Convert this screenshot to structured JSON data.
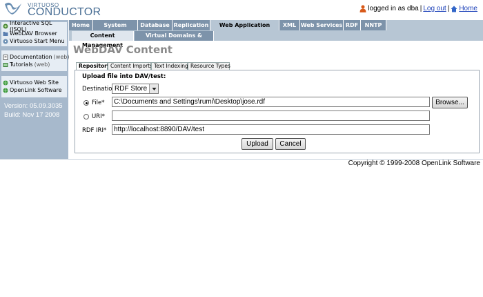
{
  "header": {
    "logo_small": "VIRTUOSO",
    "logo_big": "CONDUCTOR",
    "login_text": "logged in as dba",
    "separator": "|",
    "logout_label": "Log out",
    "home_label": "Home"
  },
  "tabs": [
    "Home",
    "System Admin",
    "Database",
    "Replication",
    "Web Application Server",
    "XML",
    "Web Services",
    "RDF",
    "NNTP"
  ],
  "active_tab": "Web Application Server",
  "subtabs": [
    "Content Management",
    "Virtual Domains & Directories"
  ],
  "active_subtab": "Content Management",
  "sidebar": {
    "group1": [
      {
        "label": "Interactive SQL (ISQL)",
        "icon": "isql-icon"
      },
      {
        "label": "WebDAV Browser",
        "icon": "folder-icon"
      },
      {
        "label": "Virtuoso Start Menu",
        "icon": "start-menu-icon"
      }
    ],
    "group2": [
      {
        "label": "Documentation",
        "suffix": "(web)",
        "icon": "book-icon"
      },
      {
        "label": "Tutorials",
        "suffix": "(web)",
        "icon": "tutorial-icon"
      }
    ],
    "group3": [
      {
        "label": "Virtuoso Web Site",
        "icon": "globe-icon"
      },
      {
        "label": "OpenLink Software",
        "icon": "globe-icon"
      }
    ],
    "version": "Version: 05.09.3035",
    "build": "Build: Nov 17 2008"
  },
  "page_title": "WebDAV Content",
  "inner_tabs": [
    "Repository",
    "Content Imports",
    "Text Indexing",
    "Resource Types"
  ],
  "active_inner_tab": "Repository",
  "form": {
    "upload_label": "Upload file into DAV/test:",
    "destination_label": "Destination",
    "destination_value": "RDF Store",
    "file_label": "File*",
    "file_value": "C:\\Documents and Settings\\rumi\\Desktop\\jose.rdf",
    "browse_label": "Browse...",
    "uri_label": "URI*",
    "uri_value": "",
    "rdf_iri_label": "RDF IRI*",
    "rdf_iri_value": "http://localhost:8890/DAV/test",
    "upload_button": "Upload",
    "cancel_button": "Cancel"
  },
  "footer": {
    "copyright": "Copyright © 1999-2008 OpenLink Software"
  },
  "colors": {
    "tab_bg": "#7d93aa",
    "tab_bar": "#b7c6d4",
    "sidebar_bg": "#a7b9cc",
    "link": "#1a3fb8"
  }
}
